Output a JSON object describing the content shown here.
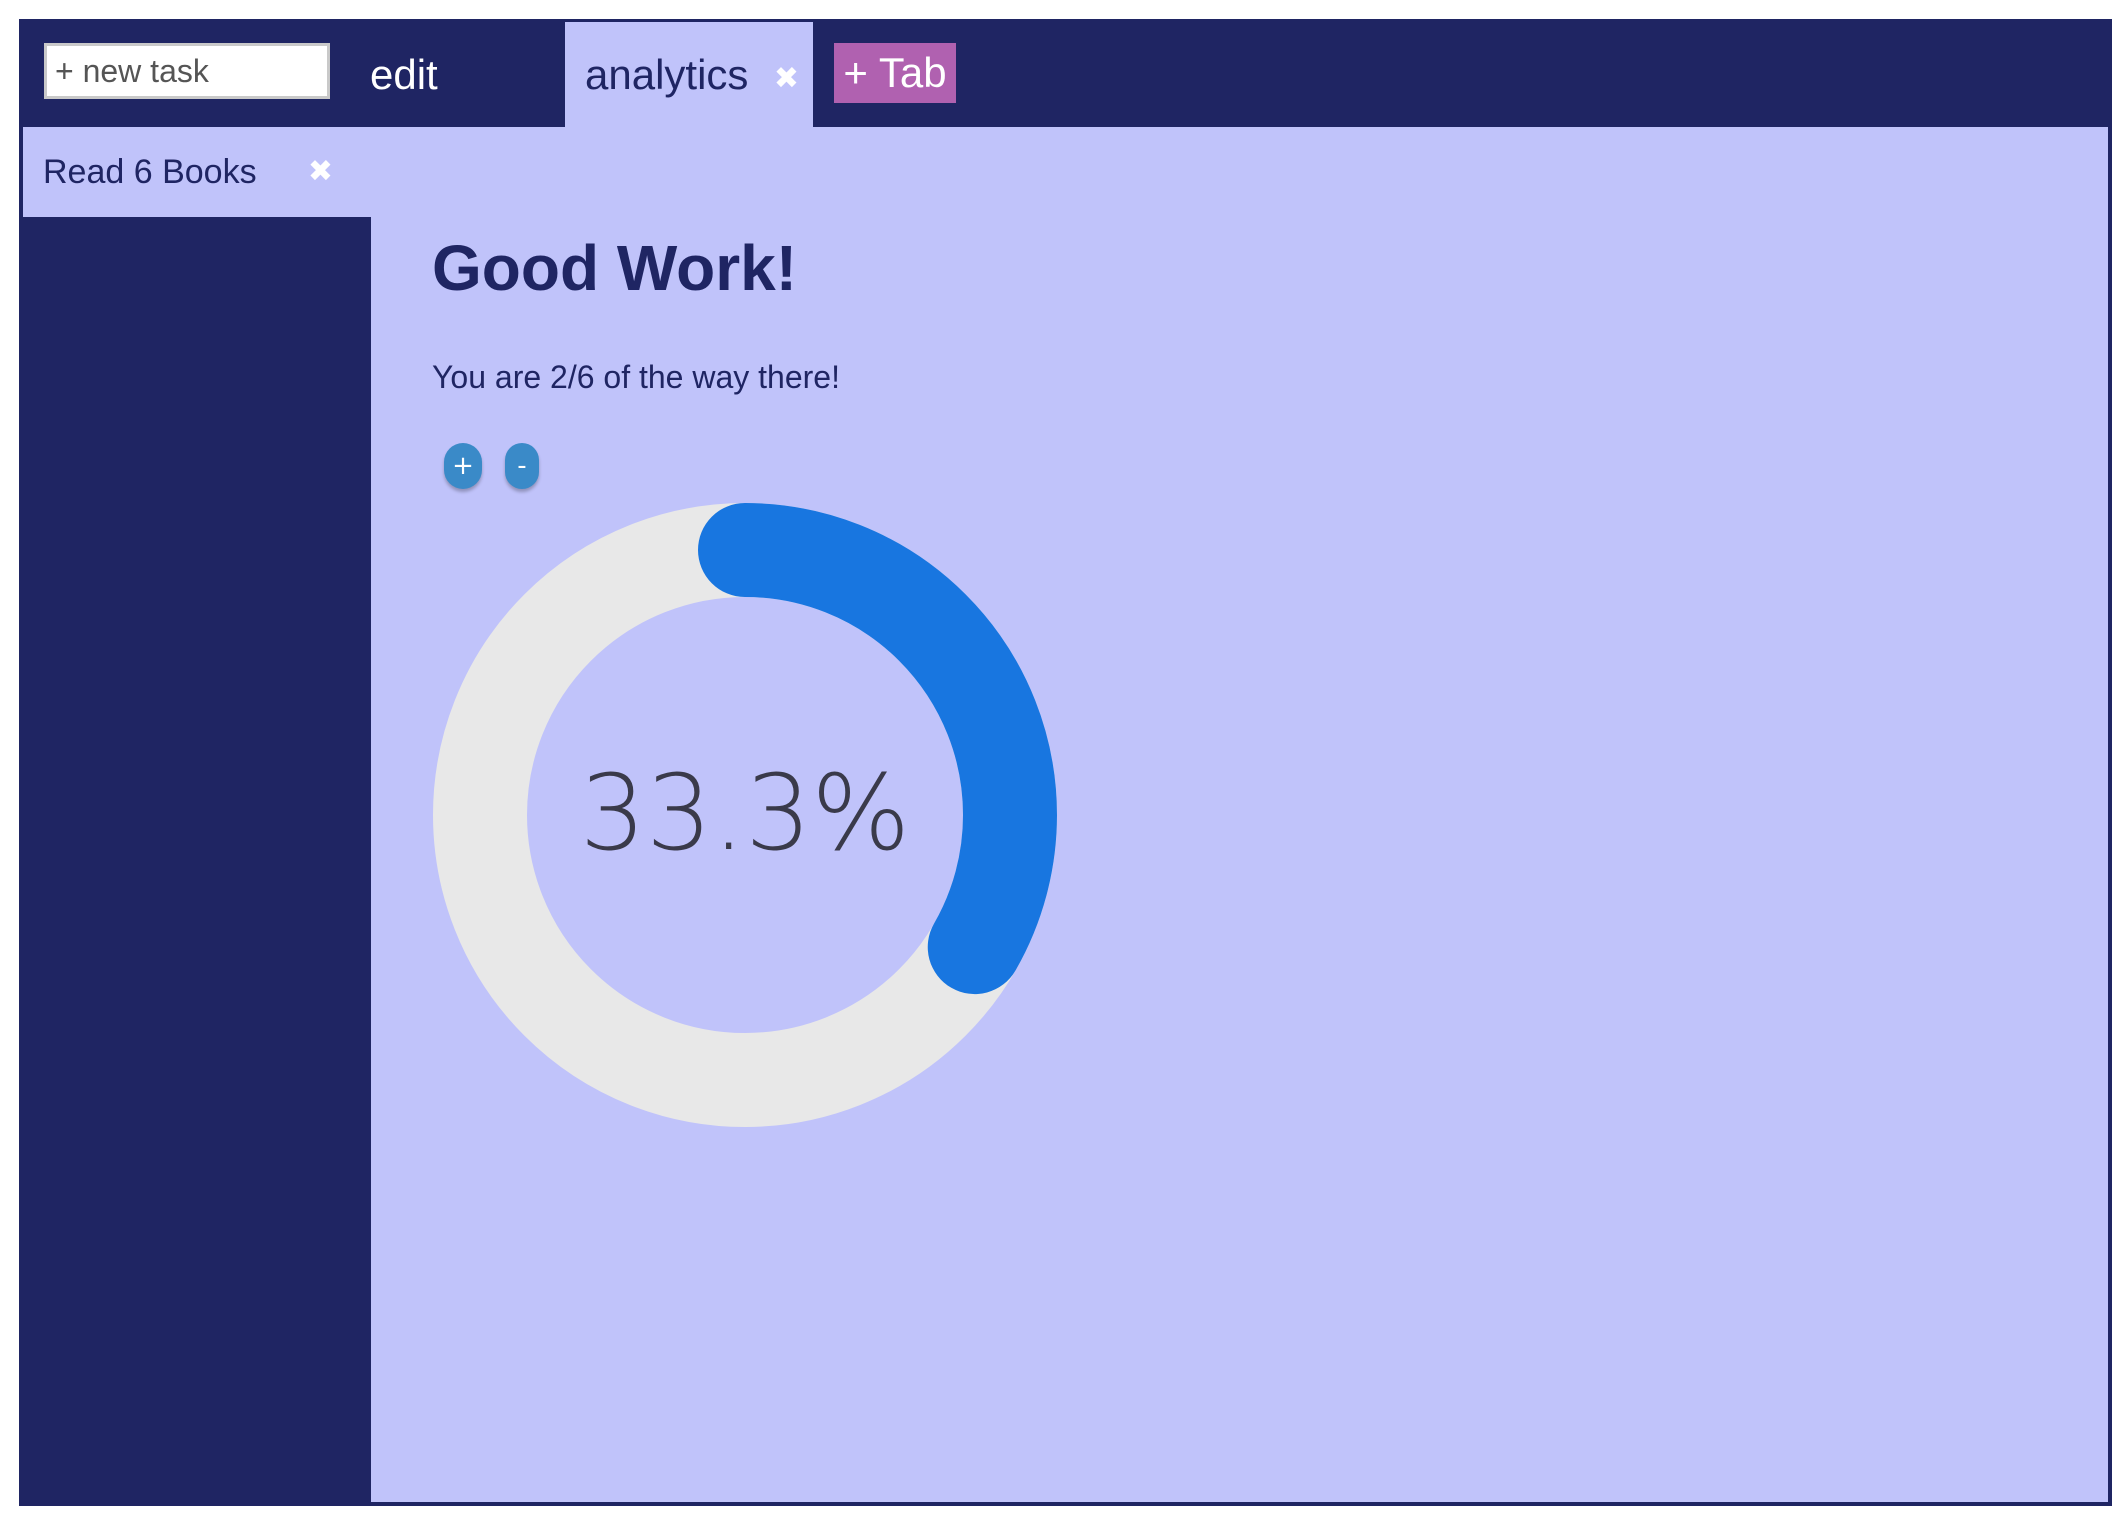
{
  "header": {
    "new_task_placeholder": "+ new task",
    "tabs": [
      {
        "label": "edit",
        "active": false
      },
      {
        "label": "analytics",
        "active": true,
        "close_icon": "✖"
      }
    ],
    "add_tab_label": "+ Tab"
  },
  "sidebar": {
    "tasks": [
      {
        "label": "Read 6 Books",
        "close_icon": "✖"
      }
    ]
  },
  "main": {
    "heading": "Good Work!",
    "subtext": "You are 2/6 of the way there!",
    "increment_label": "+",
    "decrement_label": "-",
    "progress": {
      "completed": 2,
      "total": 6,
      "fraction": 0.333,
      "label": "33.3%"
    }
  },
  "colors": {
    "navy": "#1f2563",
    "lavender": "#c0c3fa",
    "accent_purple": "#b061b0",
    "button_blue": "#3a8ac8",
    "progress_blue": "#1876e0",
    "track_gray": "#e8e8e8"
  }
}
